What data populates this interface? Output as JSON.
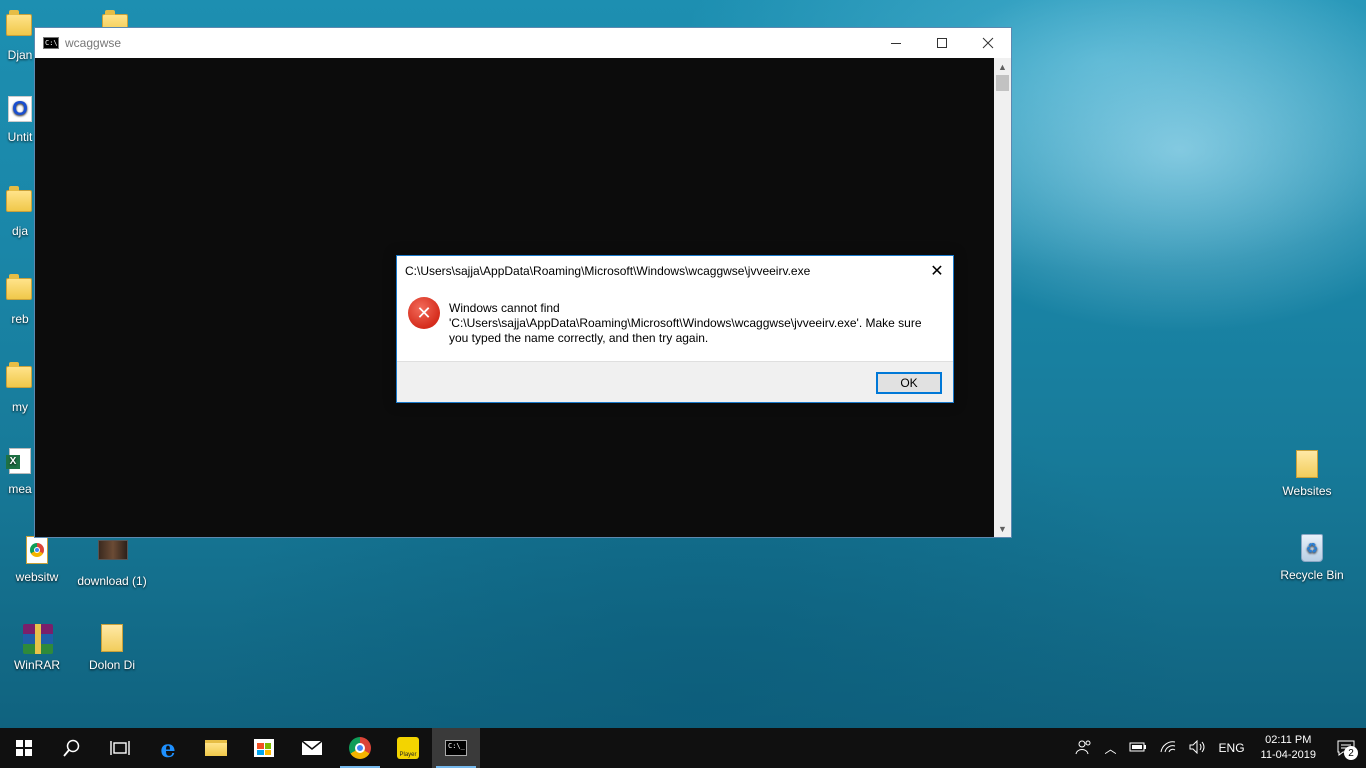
{
  "desktop": {
    "icons_left": [
      {
        "label": "Djan",
        "icon": "folder-icon"
      },
      {
        "label": "Untit",
        "icon": "app-icon"
      },
      {
        "label": "dja",
        "icon": "folder-icon"
      },
      {
        "label": "reb",
        "icon": "folder-icon"
      },
      {
        "label": "my",
        "icon": "folder-icon"
      },
      {
        "label": "mea",
        "icon": "excel-icon"
      }
    ],
    "icons": [
      {
        "label": "websitw",
        "icon": "chrome-shortcut-icon"
      },
      {
        "label": "download (1)",
        "icon": "image-file-icon"
      },
      {
        "label": "WinRAR",
        "icon": "winrar-icon"
      },
      {
        "label": "Dolon Di",
        "icon": "folder-icon"
      },
      {
        "label": "Websites",
        "icon": "folder-icon"
      },
      {
        "label": "Recycle Bin",
        "icon": "recycle-bin-icon"
      }
    ]
  },
  "console_window": {
    "title": "wcaggwse",
    "icon": "cmd-icon"
  },
  "error_dialog": {
    "title": "C:\\Users\\sajja\\AppData\\Roaming\\Microsoft\\Windows\\wcaggwse\\jvveeirv.exe",
    "message_line1": "Windows cannot find",
    "message_line2": "'C:\\Users\\sajja\\AppData\\Roaming\\Microsoft\\Windows\\wcaggwse\\jvveeirv.exe'. Make sure",
    "message_line3": "you typed the name correctly, and then try again.",
    "ok_label": "OK",
    "icon": "error-icon",
    "close_glyph": "✕"
  },
  "taskbar": {
    "apps": [
      "start-icon",
      "search-icon",
      "task-view-icon",
      "edge-icon",
      "file-explorer-icon",
      "store-icon",
      "mail-icon",
      "chrome-icon",
      "player-icon",
      "cmd-icon"
    ],
    "player_label": "Player",
    "tray": {
      "language": "ENG",
      "time": "02:11 PM",
      "date": "11-04-2019",
      "notification_count": "2"
    }
  }
}
